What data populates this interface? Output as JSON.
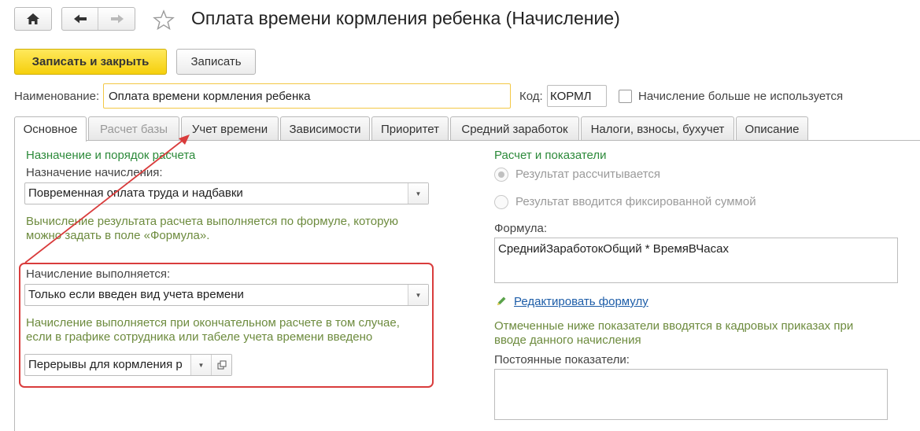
{
  "window": {
    "title": "Оплата времени кормления ребенка (Начисление)",
    "home_icon": "home-icon",
    "back_icon": "arrow-left-icon",
    "forward_icon": "arrow-right-icon",
    "favorite_icon": "star-icon"
  },
  "toolbar": {
    "save_close_label": "Записать и закрыть",
    "save_label": "Записать"
  },
  "header": {
    "name_label": "Наименование:",
    "name_value": "Оплата времени кормления ребенка",
    "code_label": "Код:",
    "code_value": "КОРМЛ",
    "not_used_label": "Начисление больше не используется"
  },
  "tabs": [
    {
      "label": "Основное",
      "state": "active"
    },
    {
      "label": "Расчет базы",
      "state": "disabled"
    },
    {
      "label": "Учет времени",
      "state": "normal"
    },
    {
      "label": "Зависимости",
      "state": "normal"
    },
    {
      "label": "Приоритет",
      "state": "normal"
    },
    {
      "label": "Средний заработок",
      "state": "normal"
    },
    {
      "label": "Налоги, взносы, бухучет",
      "state": "normal"
    },
    {
      "label": "Описание",
      "state": "normal"
    }
  ],
  "left": {
    "section_title": "Назначение и порядок расчета",
    "purpose_label": "Назначение начисления:",
    "purpose_value": "Повременная оплата труда и надбавки",
    "formula_hint": "Вычисление результата расчета выполняется по формуле, которую можно задать в поле «Формула».",
    "executed_label": "Начисление выполняется:",
    "executed_value": "Только если введен вид учета времени",
    "executed_hint": "Начисление выполняется при окончательном расчете в том случае, если в графике сотрудника или табеле учета времени введено",
    "time_type_value": "Перерывы для кормления р"
  },
  "right": {
    "section_title": "Расчет и показатели",
    "radio_calculated": "Результат рассчитывается",
    "radio_fixed": "Результат вводится фиксированной суммой",
    "formula_label": "Формула:",
    "formula_value": "СреднийЗаработокОбщий * ВремяВЧасах",
    "edit_formula_link": "Редактировать формулу",
    "indicators_hint": "Отмеченные ниже показатели вводятся в кадровых приказах при вводе данного начисления",
    "permanent_label": "Постоянные показатели:"
  },
  "colors": {
    "accent_button": "#f5cf0c",
    "section_green": "#2c8a3a",
    "hint_green": "#6d8b3e",
    "link_blue": "#1d5da8",
    "annotation_red": "#d93c3c"
  }
}
